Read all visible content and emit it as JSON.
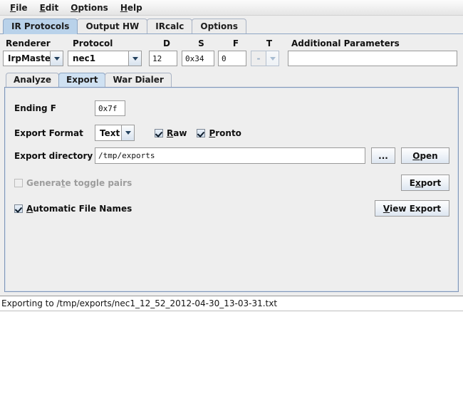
{
  "menubar": {
    "items": [
      {
        "label": "File",
        "mnemonic": "F"
      },
      {
        "label": "Edit",
        "mnemonic": "E"
      },
      {
        "label": "Options",
        "mnemonic": "O"
      },
      {
        "label": "Help",
        "mnemonic": "H"
      }
    ]
  },
  "main_tabs": {
    "selected": "IR Protocols",
    "items": [
      {
        "label": "IR Protocols"
      },
      {
        "label": "Output HW"
      },
      {
        "label": "IRcalc"
      },
      {
        "label": "Options"
      }
    ]
  },
  "param_form": {
    "renderer": {
      "label": "Renderer",
      "value": "IrpMaster"
    },
    "protocol": {
      "label": "Protocol",
      "value": "nec1"
    },
    "d": {
      "label": "D",
      "value": "12"
    },
    "s": {
      "label": "S",
      "value": "0x34"
    },
    "f": {
      "label": "F",
      "value": "0"
    },
    "t": {
      "label": "T",
      "value": "-",
      "enabled": false
    },
    "additional": {
      "label": "Additional Parameters",
      "value": "",
      "placeholder": ""
    }
  },
  "sub_tabs": {
    "selected": "Export",
    "items": [
      {
        "label": "Analyze"
      },
      {
        "label": "Export"
      },
      {
        "label": "War Dialer"
      }
    ]
  },
  "export_panel": {
    "ending_f": {
      "label": "Ending F",
      "value": "0x7f"
    },
    "export_format": {
      "label": "Export Format",
      "value": "Text"
    },
    "raw_checkbox": {
      "label": "Raw",
      "checked": true,
      "mnemonic": "R"
    },
    "pronto_checkbox": {
      "label": "Pronto",
      "checked": true,
      "mnemonic": "P"
    },
    "export_directory": {
      "label": "Export directory",
      "value": "/tmp/exports"
    },
    "browse_button": {
      "label": "..."
    },
    "open_button": {
      "label": "Open",
      "mnemonic": "O"
    },
    "toggle_pairs": {
      "label": "Generate toggle pairs",
      "checked": false,
      "enabled": false
    },
    "export_button": {
      "label": "Export",
      "mnemonic": "x"
    },
    "automatic_file_names": {
      "label": "Automatic File Names",
      "checked": true,
      "mnemonic": "A"
    },
    "view_export_button": {
      "label": "View Export",
      "mnemonic": "V"
    }
  },
  "status": {
    "text": "Exporting to /tmp/exports/nec1_12_52_2012-04-30_13-03-31.txt"
  },
  "colors": {
    "panel_border": "#8296b6",
    "selected_tab": "#b9d2ea",
    "selected_subtab": "#cfe1f2",
    "background": "#eeeeee",
    "field_background": "#ffffff"
  }
}
